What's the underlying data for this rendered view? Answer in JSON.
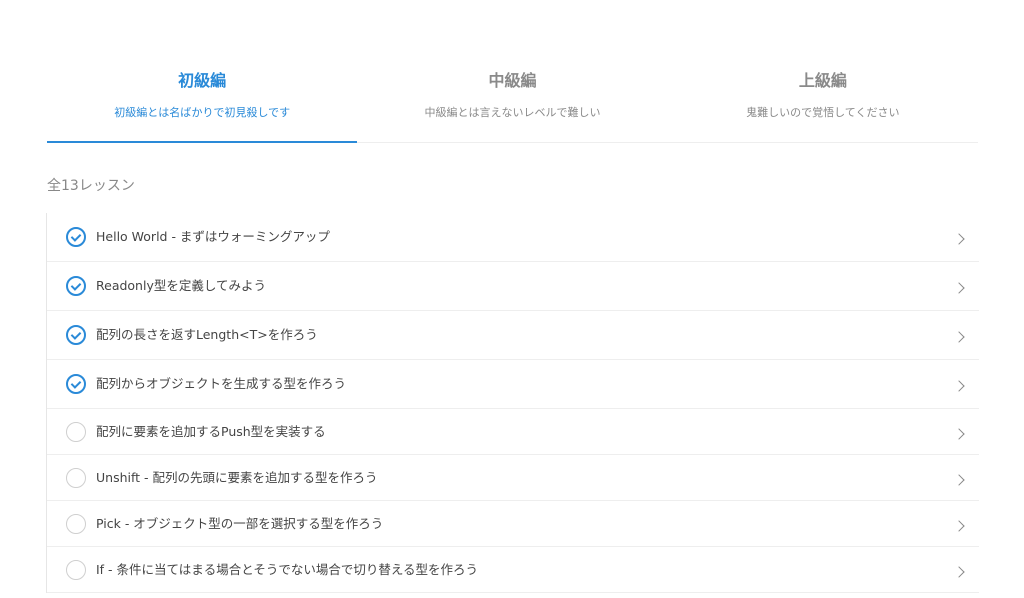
{
  "tabs": [
    {
      "title": "初級編",
      "subtitle": "初級編とは名ばかりで初見殺しです",
      "active": true
    },
    {
      "title": "中級編",
      "subtitle": "中級編とは言えないレベルで難しい",
      "active": false
    },
    {
      "title": "上級編",
      "subtitle": "鬼難しいので覚悟してください",
      "active": false
    }
  ],
  "lesson_count": "全13レッスン",
  "lessons": [
    {
      "title": "Hello World - まずはウォーミングアップ",
      "status": "completed"
    },
    {
      "title": "Readonly型を定義してみよう",
      "status": "completed"
    },
    {
      "title": "配列の長さを返すLength<T>を作ろう",
      "status": "completed"
    },
    {
      "title": "配列からオブジェクトを生成する型を作ろう",
      "status": "completed"
    },
    {
      "title": "配列に要素を追加するPush型を実装する",
      "status": "incomplete"
    },
    {
      "title": "Unshift - 配列の先頭に要素を追加する型を作ろう",
      "status": "incomplete"
    },
    {
      "title": "Pick - オブジェクト型の一部を選択する型を作ろう",
      "status": "incomplete"
    },
    {
      "title": "If - 条件に当てはまる場合とそうでない場合で切り替える型を作ろう",
      "status": "incomplete"
    }
  ],
  "colors": {
    "accent": "#2a8ad8",
    "inactive_text": "#8a8a8a",
    "divider": "#eeeeee"
  },
  "icons": {
    "completed": "check-circle-icon",
    "incomplete": "empty-circle-icon",
    "row_action": "chevron-right-icon"
  }
}
